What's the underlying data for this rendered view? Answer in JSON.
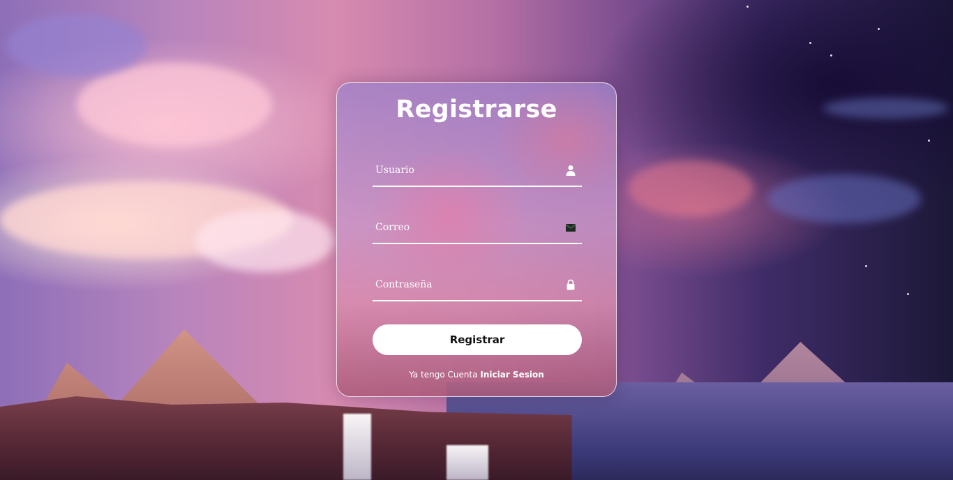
{
  "form": {
    "title": "Registrarse",
    "fields": {
      "username": {
        "placeholder": "Usuario",
        "icon": "user-icon"
      },
      "email": {
        "placeholder": "Correo",
        "icon": "mail-icon"
      },
      "password": {
        "placeholder": "Contraseña",
        "icon": "lock-icon"
      }
    },
    "submit_label": "Registrar",
    "footer": {
      "text": "Ya tengo Cuenta",
      "link_label": "Iniciar Sesion"
    }
  },
  "colors": {
    "card_border": "#ffffff",
    "button_bg": "#ffffff",
    "button_text": "#111111",
    "text": "#ffffff"
  }
}
